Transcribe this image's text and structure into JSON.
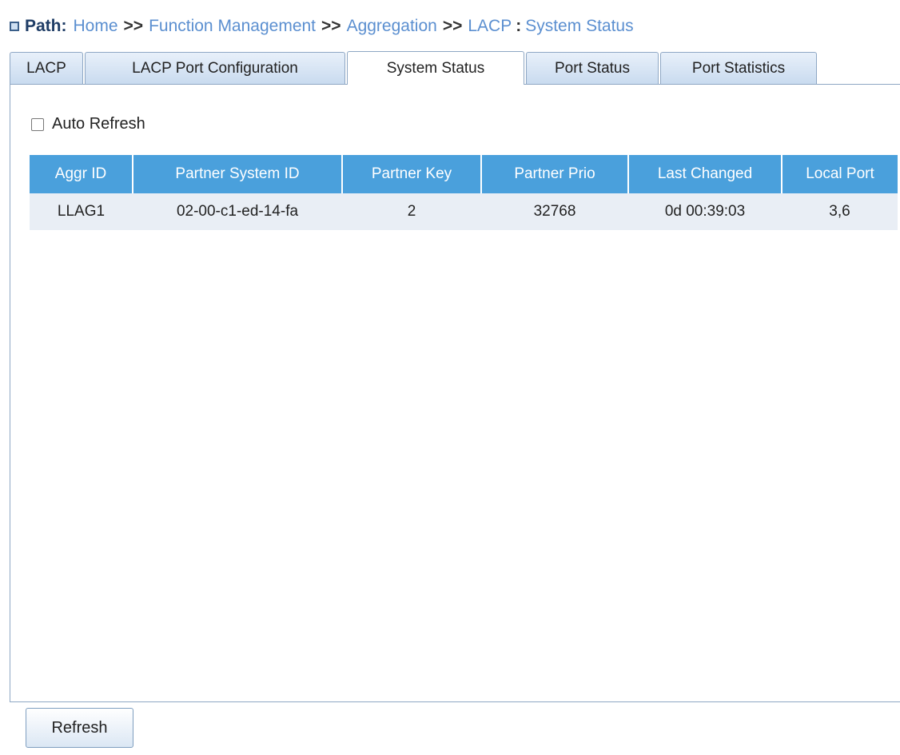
{
  "path": {
    "label": "Path:",
    "crumbs": [
      "Home",
      "Function Management",
      "Aggregation",
      "LACP"
    ],
    "separator": ">>",
    "colon": ":",
    "current": "System Status"
  },
  "tabs": [
    {
      "label": "LACP",
      "active": false
    },
    {
      "label": "LACP Port Configuration",
      "active": false
    },
    {
      "label": "System Status",
      "active": true
    },
    {
      "label": "Port Status",
      "active": false
    },
    {
      "label": "Port Statistics",
      "active": false
    }
  ],
  "auto_refresh": {
    "label": "Auto Refresh",
    "checked": false
  },
  "table": {
    "headers": [
      "Aggr ID",
      "Partner System ID",
      "Partner Key",
      "Partner Prio",
      "Last Changed",
      "Local Port"
    ],
    "rows": [
      [
        "LLAG1",
        "02-00-c1-ed-14-fa",
        "2",
        "32768",
        "0d 00:39:03",
        "3,6"
      ]
    ]
  },
  "buttons": {
    "refresh": "Refresh"
  },
  "colors": {
    "header_bg": "#4aa0dc",
    "row_bg": "#e9eef5",
    "link": "#5b8fd0"
  }
}
